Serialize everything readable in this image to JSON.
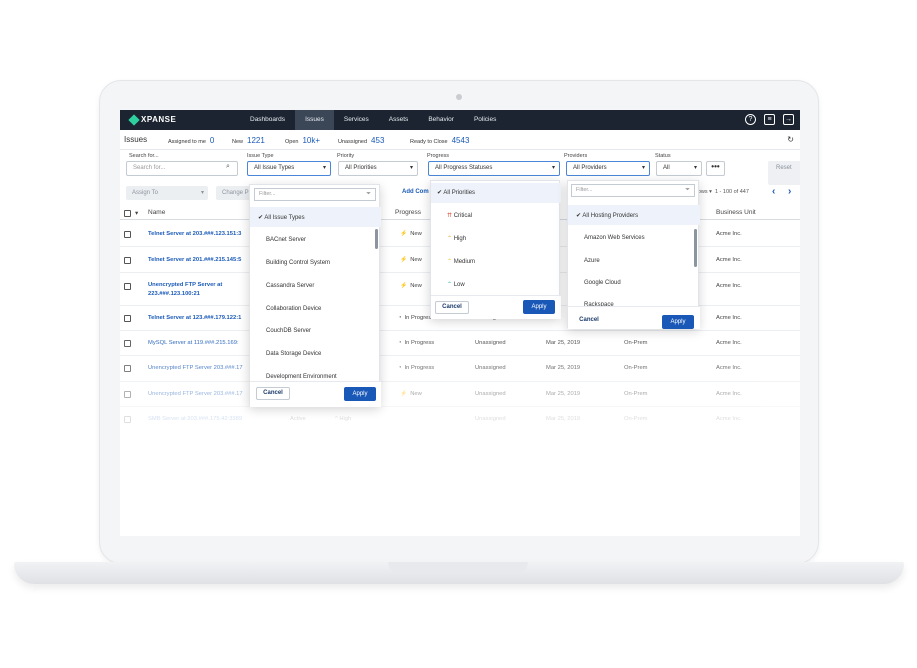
{
  "app": {
    "brand": "XPANSE",
    "nav": [
      "Dashboards",
      "Issues",
      "Services",
      "Assets",
      "Behavior",
      "Policies"
    ],
    "active_nav": "Issues",
    "icons": [
      "help-icon",
      "document-icon",
      "logout-icon"
    ]
  },
  "summary": {
    "title": "Issues",
    "assigned_label": "Assigned to me",
    "assigned_value": "0",
    "new_label": "New",
    "new_value": "1221",
    "open_label": "Open",
    "open_value": "10k+",
    "unassigned_label": "Unassigned",
    "unassigned_value": "453",
    "ready_label": "Ready to Close",
    "ready_value": "4543"
  },
  "filters": {
    "search_label": "Search for...",
    "search_placeholder": "Search for...",
    "issue_type_label": "Issue Type",
    "issue_type_value": "All Issue Types",
    "priority_label": "Priority",
    "priority_value": "All Priorities",
    "progress_label": "Progress",
    "progress_value": "All Progress Statuses",
    "providers_label": "Providers",
    "providers_value": "All Providers",
    "status_label": "Status",
    "status_value": "All",
    "more": "•••",
    "reset": "Reset"
  },
  "actions": {
    "assign": "Assign To",
    "change": "Change P",
    "add": "Add Com",
    "rows": "rows ▾",
    "range": "1 - 100 of 447"
  },
  "table": {
    "headers": [
      "Name",
      "Progress",
      "Business Unit"
    ],
    "rows": [
      {
        "name": "Telnet Server at 203.###.123.151:3",
        "progress": "New",
        "assignee": "",
        "date": "",
        "env": "",
        "unit": "Acme Inc."
      },
      {
        "name": "Telnet Server at 201.###.215.145:5",
        "progress": "New",
        "assignee": "",
        "date": "",
        "env": "",
        "unit": "Acme Inc."
      },
      {
        "name": "Unencrypted FTP Server at",
        "name2": "223.###.123.100:21",
        "progress": "New",
        "assignee": "",
        "date": "",
        "env": "",
        "unit": "Acme Inc."
      },
      {
        "name": "Telnet Server at 123.###.179.122:1",
        "progress": "In Progress",
        "assignee": "Unassigned",
        "date": "",
        "env": "",
        "unit": "Acme Inc."
      },
      {
        "name": "MySQL Server at 119.###.215.169:",
        "progress": "In Progress",
        "assignee": "Unassigned",
        "date": "Mar 25, 2019",
        "env": "On-Prem",
        "unit": "Acme Inc."
      },
      {
        "name": "Unencrypted FTP Server 203.###.17",
        "progress": "In Progress",
        "assignee": "Unassigned",
        "date": "Mar 25, 2019",
        "env": "On-Prem",
        "unit": "Acme Inc."
      },
      {
        "name": "Unencrypted FTP Server 203.###.17",
        "progress": "New",
        "assignee": "Unassigned",
        "date": "Mar 25, 2019",
        "env": "On-Prem",
        "unit": "Acme Inc."
      },
      {
        "name": "SMB Server at 203.###.175.42:3389",
        "status": "Active",
        "priority": "High",
        "assignee": "Unassigned",
        "date": "Mar 25, 2019",
        "env": "On-Prem",
        "unit": "Acme Inc."
      }
    ]
  },
  "issue_type_dropdown": {
    "filter": "Filter...",
    "items": [
      "All Issue Types",
      "BACnet Server",
      "Building Control System",
      "Cassandra Server",
      "Collaboration Device",
      "CouchDB Server",
      "Data Storage Device",
      "Development Environment"
    ],
    "cancel": "Cancel",
    "apply": "Apply"
  },
  "progress_dropdown": {
    "items": [
      "All Priorities",
      "Critical",
      "High",
      "Medium",
      "Low"
    ],
    "cancel": "Cancel",
    "apply": "Apply"
  },
  "providers_dropdown": {
    "filter": "Filter...",
    "items": [
      "All Hosting Providers",
      "Amazon Web Services",
      "Azure",
      "Google Cloud",
      "Rackspace"
    ],
    "cancel": "Cancel",
    "apply": "Apply"
  },
  "colors": {
    "nav_bg": "#1b2430",
    "link": "#1a5ab8",
    "apply": "#1a58b8",
    "critical": "#e0503a",
    "high": "#f0a020",
    "medium": "#f0c020",
    "low": "#2fb5a0"
  }
}
